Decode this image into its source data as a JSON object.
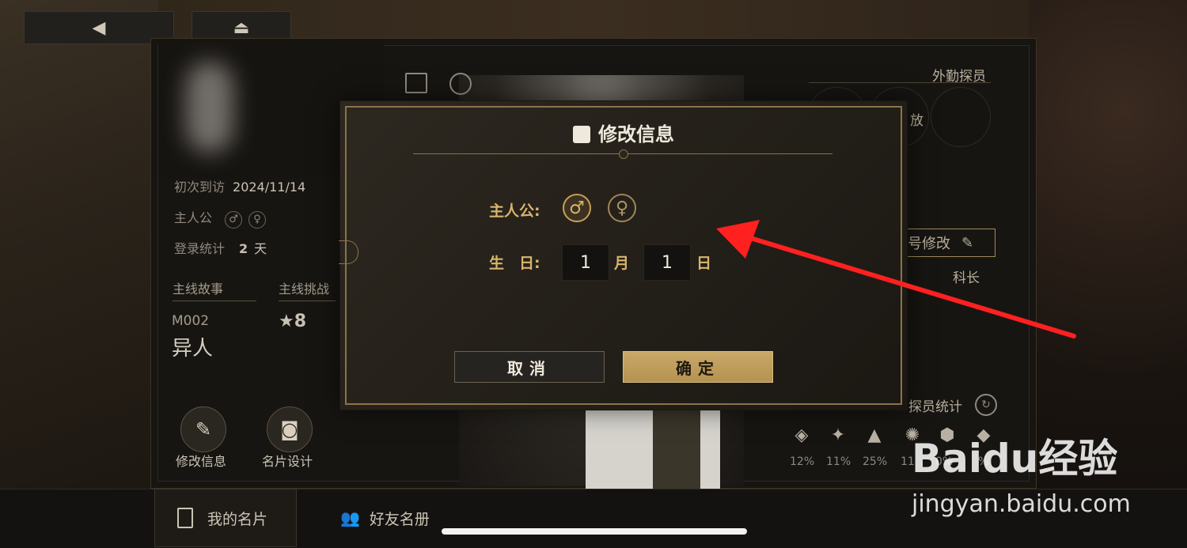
{
  "top_buttons": {
    "back_icon": "◀",
    "menu_icon": "⏏"
  },
  "profile": {
    "first_visit_label": "初次到访",
    "first_visit_value": "2024/11/14",
    "protagonist_label": "主人公",
    "male_symbol": "♂",
    "female_symbol": "♀",
    "login_label": "登录统计",
    "login_value": "2",
    "login_unit": "天",
    "main_story_label": "主线故事",
    "main_challenge_label": "主线挑战",
    "story_code": "M002",
    "story_name": "异人",
    "challenge_stars": "★8"
  },
  "actions": {
    "edit_info_label": "修改信息",
    "card_design_label": "名片设计"
  },
  "right_panel": {
    "field_agent_label": "外勤探员",
    "partial_text": "放",
    "rank_edit_label": "号修改",
    "rank_title": "科长",
    "agent_stats_label": "探员统计",
    "stat_percents": [
      "12%",
      "11%",
      "25%",
      "11",
      "0%",
      "%"
    ]
  },
  "modal": {
    "title": "修改信息",
    "protagonist_label": "主人公:",
    "male_symbol": "♂",
    "female_symbol": "♀",
    "birthday_label": "生　日:",
    "month_value": "1",
    "month_unit": "月",
    "day_value": "1",
    "day_unit": "日",
    "cancel_label": "取消",
    "confirm_label": "确定"
  },
  "tabs": {
    "my_card_label": "我的名片",
    "friends_label": "好友名册"
  },
  "watermark": {
    "brand": "Baidu经验",
    "url": "jingyan.baidu.com"
  },
  "colors": {
    "gold": "#d8b56c",
    "arrow": "#ff2020"
  }
}
